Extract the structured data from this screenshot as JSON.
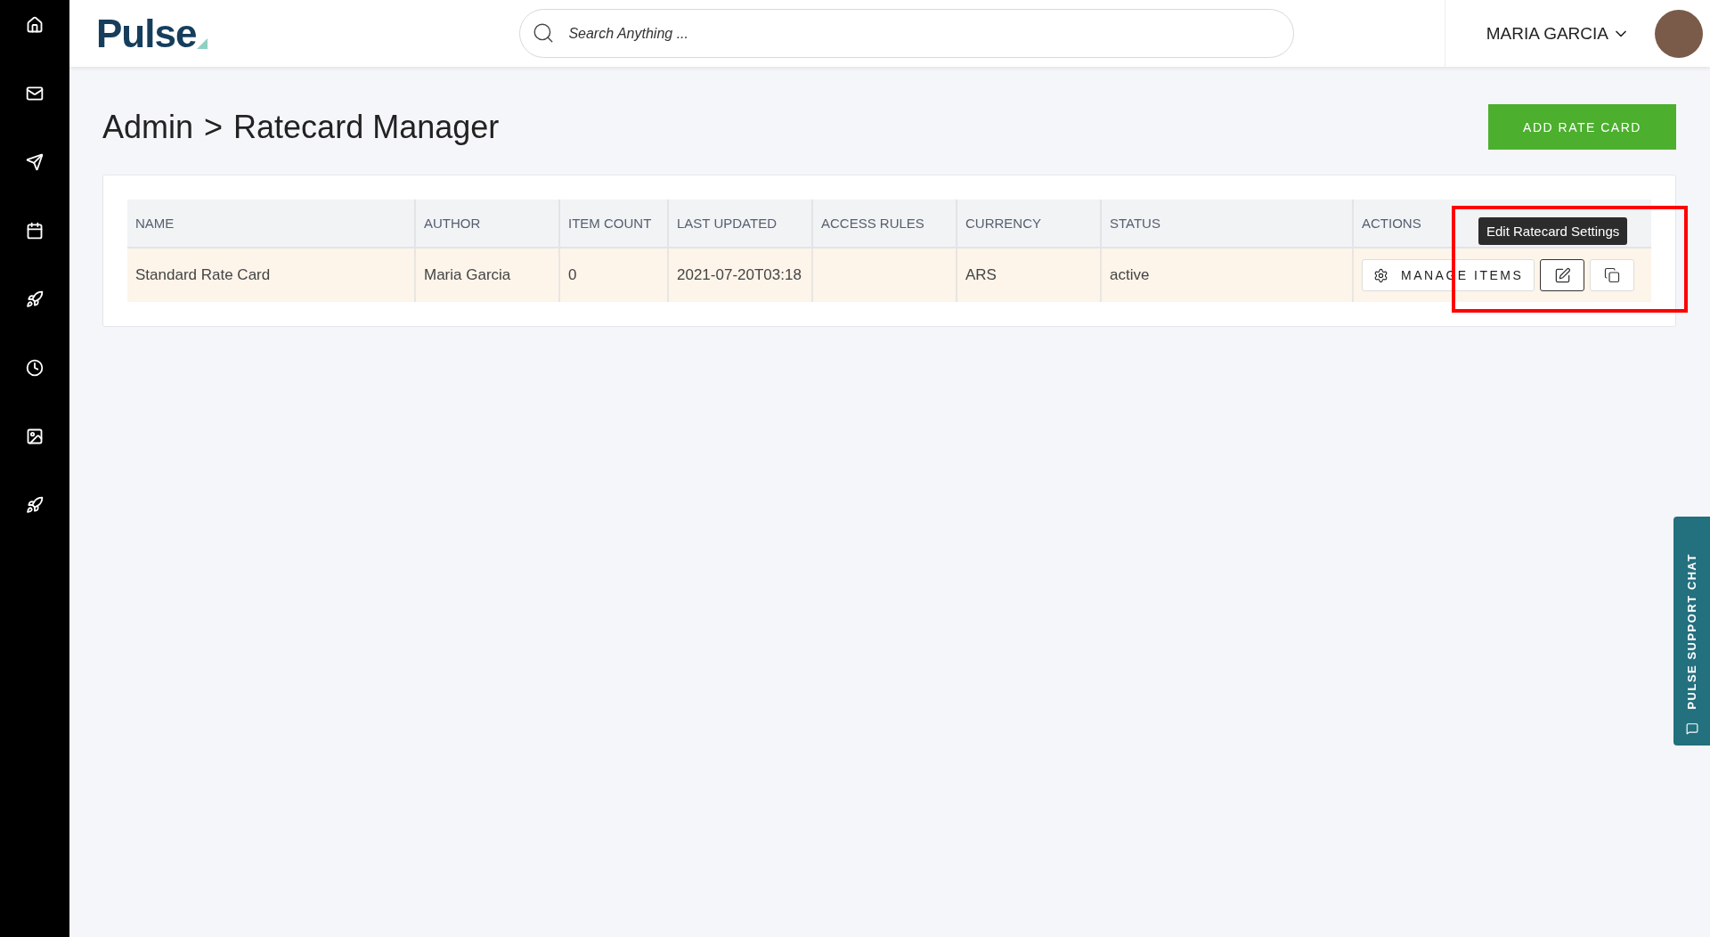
{
  "header": {
    "logo": "Pulse",
    "search": {
      "placeholder": "Search Anything ..."
    },
    "user": "MARIA GARCIA"
  },
  "page": {
    "breadcrumb": [
      "Admin",
      "Ratecard Manager"
    ],
    "separator": ">",
    "add_button": "ADD RATE CARD"
  },
  "table": {
    "columns": [
      "NAME",
      "AUTHOR",
      "ITEM COUNT",
      "LAST UPDATED",
      "ACCESS RULES",
      "CURRENCY",
      "STATUS",
      "ACTIONS"
    ],
    "rows": [
      {
        "cells": [
          "Standard Rate Card",
          "Maria Garcia",
          "0",
          "2021-07-20T03:18",
          null,
          "ARS",
          "active"
        ],
        "manage_button": "MANAGE ITEMS"
      }
    ]
  },
  "tooltip": "Edit Ratecard Settings",
  "support_chat": "PULSE SUPPORT CHAT"
}
